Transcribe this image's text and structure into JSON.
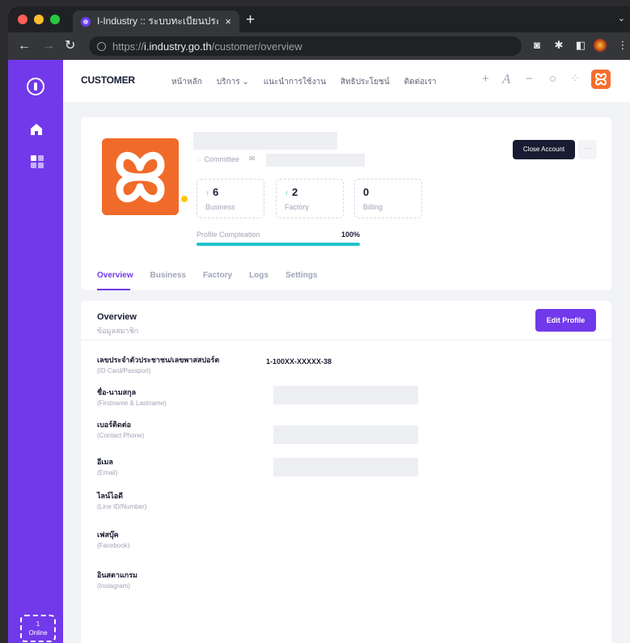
{
  "browser": {
    "tab_title": "I-Industry :: ระบบทะเบียนประวัติ",
    "tab_close": "×",
    "new_tab": "+",
    "url_scheme": "https://",
    "url_host": "i.industry.go.th",
    "url_path": "/customer/overview"
  },
  "header": {
    "brand": "CUSTOMER",
    "menu": [
      "หน้าหลัก",
      "บริการ ⌄",
      "แนะนำการใช้งาน",
      "สิทธิประโยชน์",
      "ติดต่อเรา"
    ],
    "tools": {
      "plus": "+",
      "font": "A",
      "minus": "−",
      "search": "○",
      "theme": "⁘"
    }
  },
  "profile": {
    "role": "Committee",
    "stats": [
      {
        "value": "6",
        "label": "Business",
        "arrow": "↑"
      },
      {
        "value": "2",
        "label": "Factory",
        "arrow": "↑"
      },
      {
        "value": "0",
        "label": "Billing",
        "arrow": ""
      }
    ],
    "progress_label": "Profile Compleation",
    "progress_value": "100%",
    "progress_fraction": 1.0,
    "close_account": "Close Account",
    "more": "···",
    "tabs": [
      "Overview",
      "Business",
      "Factory",
      "Logs",
      "Settings"
    ],
    "active_tab": "Overview"
  },
  "overview": {
    "title": "Overview",
    "subtitle": "ข้อมูลสมาชิก",
    "edit_button": "Edit Profile",
    "fields": [
      {
        "th": "เลขประจำตัวประชาชน/เลขพาสสปอร์ต",
        "en": "(ID Card/Passport)",
        "value": "1-100XX-XXXXX-38"
      },
      {
        "th": "ชื่อ-นามสกุล",
        "en": "(Firstname & Lastname)",
        "value": ""
      },
      {
        "th": "เบอร์ติดต่อ",
        "en": "(Contact Phone)",
        "value": ""
      },
      {
        "th": "อีเมล",
        "en": "(Email)",
        "value": ""
      },
      {
        "th": "ไลน์ไอดี",
        "en": "(Line ID/Number)",
        "value": ""
      },
      {
        "th": "เฟสบุ๊ค",
        "en": "(Facebook)",
        "value": ""
      },
      {
        "th": "อินสตาแกรม",
        "en": "(Instagram)",
        "value": ""
      }
    ]
  },
  "sidebar": {
    "online_count": "1",
    "online_label": "Online"
  },
  "colors": {
    "primary": "#7239ea",
    "brand_orange": "#f06b2a",
    "accent_teal": "#1fc3cb",
    "dark": "#181c32"
  }
}
